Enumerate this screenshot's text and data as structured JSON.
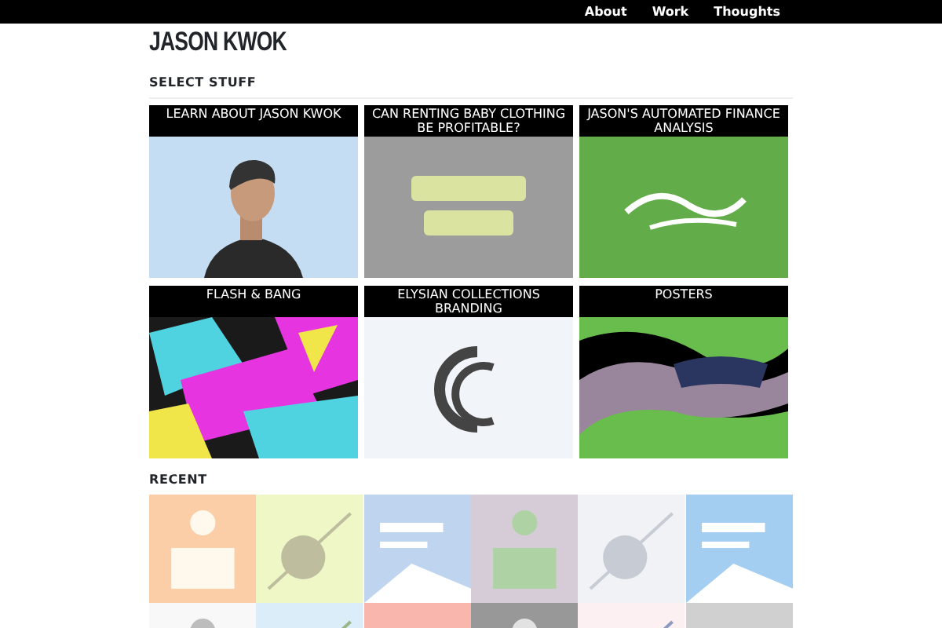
{
  "nav": [
    {
      "label": "About"
    },
    {
      "label": "Work"
    },
    {
      "label": "Thoughts"
    }
  ],
  "site_title": "JASON KWOK",
  "featured": {
    "heading": "SELECT STUFF",
    "projects": [
      {
        "title": "LEARN ABOUT JASON KWOK",
        "kind": "picture"
      },
      {
        "title": "CAN RENTING BABY CLOTHING BE PROFITABLE?",
        "kind": "picture"
      },
      {
        "title": "JASON'S AUTOMATED FINANCE ANALYSIS",
        "kind": "picture"
      },
      {
        "title": "FLASH & BANG",
        "kind": "picture"
      },
      {
        "title": "ELYSIAN COLLECTIONS BRANDING",
        "kind": "picture"
      },
      {
        "title": "POSTERS",
        "kind": "picture"
      }
    ]
  },
  "recent": {
    "heading": "RECENT"
  }
}
